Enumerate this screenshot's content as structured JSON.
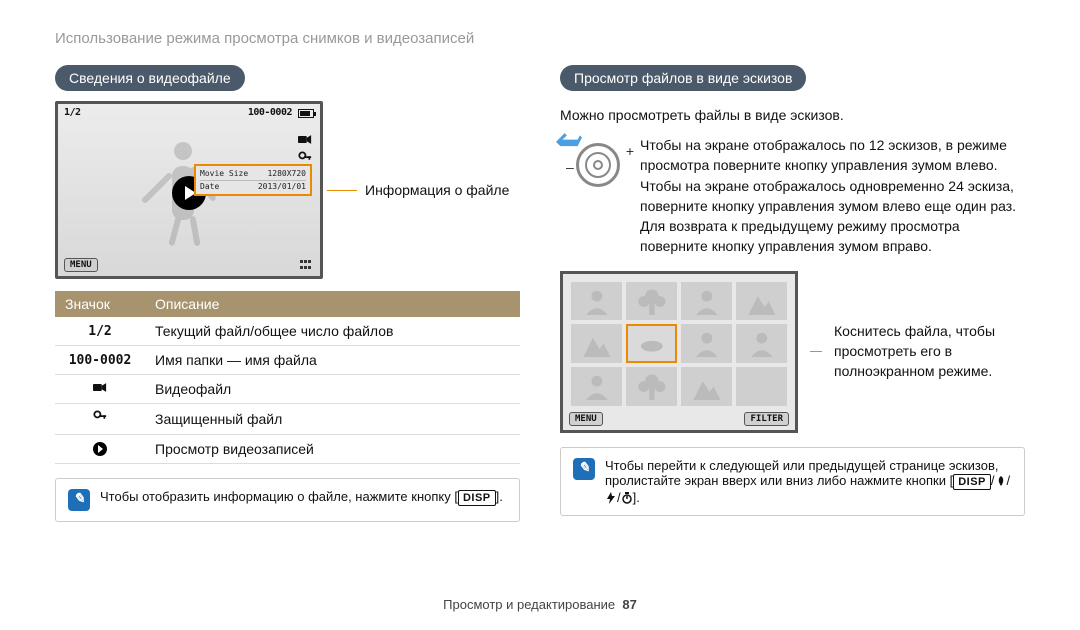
{
  "breadcrumb": "Использование режима просмотра снимков и видеозаписей",
  "left": {
    "heading": "Сведения о видеофайле",
    "screen": {
      "counter": "1/2",
      "filenum": "100-0002",
      "info_rows": [
        {
          "k": "Movie Size",
          "v": "1280X720"
        },
        {
          "k": "Date",
          "v": "2013/01/01"
        }
      ],
      "menu": "MENU"
    },
    "info_label": "Информация о файле",
    "table": {
      "head": {
        "icon": "Значок",
        "desc": "Описание"
      },
      "rows": [
        {
          "icon": "1/2",
          "desc": "Текущий файл/общее число файлов",
          "type": "text"
        },
        {
          "icon": "100-0002",
          "desc": "Имя папки — имя файла",
          "type": "text"
        },
        {
          "icon": "videocam",
          "desc": "Видеофайл",
          "type": "svg"
        },
        {
          "icon": "key",
          "desc": "Защищенный файл",
          "type": "svg"
        },
        {
          "icon": "play",
          "desc": "Просмотр видеозаписей",
          "type": "play"
        }
      ]
    },
    "note_pre": "Чтобы отобразить информацию о файле, нажмите кнопку [",
    "note_disp": "DISP",
    "note_post": "]."
  },
  "right": {
    "heading": "Просмотр файлов в виде эскизов",
    "subtitle": "Можно просмотреть файлы в виде эскизов.",
    "zoom_text": "Чтобы на экране отображалось по 12 эскизов, в режиме просмотра поверните кнопку управления зумом влево. Чтобы на экране отображалось одновременно 24 эскиза, поверните кнопку управления зумом влево еще один раз. Для возврата к предыдущему режиму просмотра поверните кнопку управления зумом вправо.",
    "minus": "–",
    "plus": "+",
    "thumb_screen": {
      "menu": "MENU",
      "filter": "FILTER"
    },
    "thumb_label": "Коснитесь файла, чтобы просмотреть его в полноэкранном режиме.",
    "note_pre": "Чтобы перейти к следующей или предыдущей странице эскизов, пролистайте экран вверх или вниз либо нажмите кнопки [",
    "note_disp": "DISP",
    "note_mid": "/",
    "note_post": "]."
  },
  "footer": {
    "section": "Просмотр и редактирование",
    "page": "87"
  }
}
